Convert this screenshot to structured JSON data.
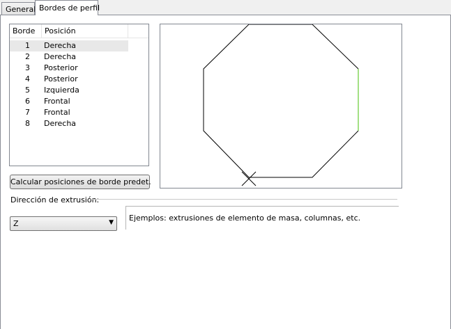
{
  "tabs": {
    "general": "General",
    "profile_edges": "Bordes de perfil"
  },
  "list": {
    "headers": [
      "Borde",
      "Posición"
    ],
    "rows": [
      {
        "num": "1",
        "pos": "Derecha"
      },
      {
        "num": "2",
        "pos": "Derecha"
      },
      {
        "num": "3",
        "pos": "Posterior"
      },
      {
        "num": "4",
        "pos": "Posterior"
      },
      {
        "num": "5",
        "pos": "Izquierda"
      },
      {
        "num": "6",
        "pos": "Frontal"
      },
      {
        "num": "7",
        "pos": "Frontal"
      },
      {
        "num": "8",
        "pos": "Derecha"
      }
    ],
    "selected_row": 1
  },
  "preview": {
    "shape": "octagon",
    "edge_color": "#000000",
    "highlight_color": "#66cc33",
    "highlight_edge": "right-vertical",
    "start_marker": "cross-arrow"
  },
  "buttons": {
    "calc_default": "Calcular posiciones de borde predet."
  },
  "extrusion": {
    "label": "Dirección de extrusión:",
    "selected": "Z",
    "example": "Ejemplos: extrusiones de elemento de masa, columnas, etc."
  }
}
